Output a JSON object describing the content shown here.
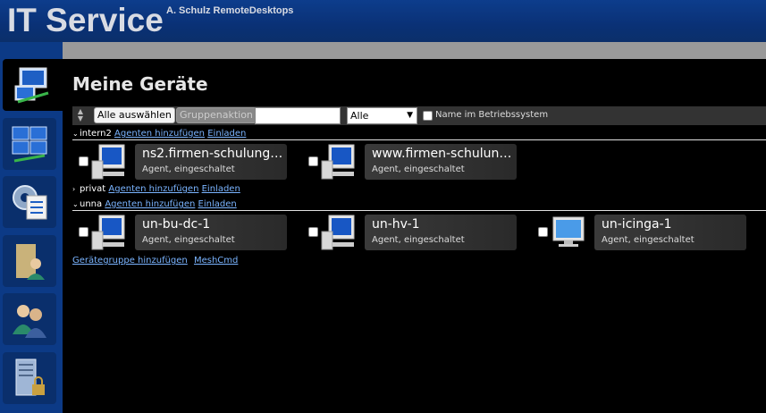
{
  "app": {
    "title": "IT Service",
    "subtitle": "A. Schulz RemoteDesktops"
  },
  "rail": {
    "items": [
      {
        "id": "my-devices",
        "icon": "network-devices-icon",
        "active": true
      },
      {
        "id": "device-groups",
        "icon": "multi-computer-icon",
        "active": false
      },
      {
        "id": "settings",
        "icon": "settings-gear-icon",
        "active": false
      },
      {
        "id": "files",
        "icon": "user-folder-icon",
        "active": false
      },
      {
        "id": "users",
        "icon": "users-icon",
        "active": false
      },
      {
        "id": "server",
        "icon": "server-lock-icon",
        "active": false
      }
    ]
  },
  "page": {
    "title": "Meine Geräte"
  },
  "toolbar": {
    "select_all_label": "Alle auswählen",
    "group_action_label": "Gruppenaktion",
    "search_value": "",
    "filter_selected": "Alle",
    "os_name_label": "Name im Betriebssystem"
  },
  "groups": [
    {
      "name": "intern2",
      "expanded": true,
      "add_agent": "Agenten hinzufügen",
      "invite": "Einladen",
      "devices": [
        {
          "name": "ns2.firmen-schulungen...",
          "state": "Agent, eingeschaltet",
          "icon": "computer-icon"
        },
        {
          "name": "www.firmen-schulunge...",
          "state": "Agent, eingeschaltet",
          "icon": "computer-icon"
        }
      ]
    },
    {
      "name": "privat",
      "expanded": false,
      "add_agent": "Agenten hinzufügen",
      "invite": "Einladen",
      "devices": []
    },
    {
      "name": "unna",
      "expanded": true,
      "add_agent": "Agenten hinzufügen",
      "invite": "Einladen",
      "devices": [
        {
          "name": "un-bu-dc-1",
          "state": "Agent, eingeschaltet",
          "icon": "computer-icon"
        },
        {
          "name": "un-hv-1",
          "state": "Agent, eingeschaltet",
          "icon": "computer-icon"
        },
        {
          "name": "un-icinga-1",
          "state": "Agent, eingeschaltet",
          "icon": "monitor-icon"
        }
      ]
    }
  ],
  "footer_links": {
    "add_group": "Gerätegruppe hinzufügen",
    "meshcmd": "MeshCmd"
  },
  "colors": {
    "header": "#0a3176",
    "rail": "#0c3a86",
    "link": "#7ab4ff",
    "background": "#000000"
  }
}
